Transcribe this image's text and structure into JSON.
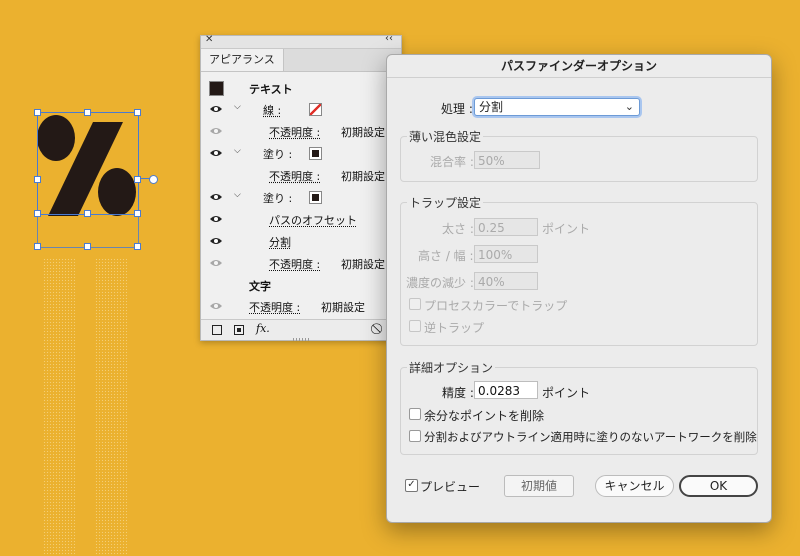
{
  "canvas": {
    "glyph": "%"
  },
  "appearance_panel": {
    "tab_label": "アピアランス",
    "rows": [
      {
        "label": "テキスト"
      },
      {
        "label": "線 :"
      },
      {
        "label": "不透明度 :",
        "value": "初期設定"
      },
      {
        "label": "塗り :"
      },
      {
        "label": "不透明度 :",
        "value": "初期設定"
      },
      {
        "label": "塗り :"
      },
      {
        "label": "パスのオフセット"
      },
      {
        "label": "分割"
      },
      {
        "label": "不透明度 :",
        "value": "初期設定"
      },
      {
        "label": "文字"
      },
      {
        "label": "不透明度 :",
        "value": "初期設定"
      }
    ],
    "fx_label": "fx."
  },
  "dialog": {
    "title": "パスファインダーオプション",
    "process_label": "処理 :",
    "process_value": "分割",
    "blend_group": {
      "title": "薄い混色設定",
      "ratio_label": "混合率 :",
      "ratio_value": "50%"
    },
    "trap_group": {
      "title": "トラップ設定",
      "thickness_label": "太さ :",
      "thickness_value": "0.25",
      "thickness_unit": "ポイント",
      "height_width_label": "高さ / 幅 :",
      "height_width_value": "100%",
      "tint_reduction_label": "濃度の減少 :",
      "tint_reduction_value": "40%",
      "process_color_trap": "プロセスカラーでトラップ",
      "reverse_trap": "逆トラップ"
    },
    "detail_group": {
      "title": "詳細オプション",
      "precision_label": "精度 :",
      "precision_value": "0.0283",
      "precision_unit": "ポイント",
      "remove_redundant": "余分なポイントを削除",
      "remove_unpainted": "分割およびアウトライン適用時に塗りのないアートワークを削除"
    },
    "preview_label": "プレビュー",
    "default_button": "初期値",
    "cancel_button": "キャンセル",
    "ok_button": "OK"
  },
  "colors": {
    "background": "#ebb12f",
    "glyph": "#231916",
    "selection": "#4a7bd0"
  }
}
